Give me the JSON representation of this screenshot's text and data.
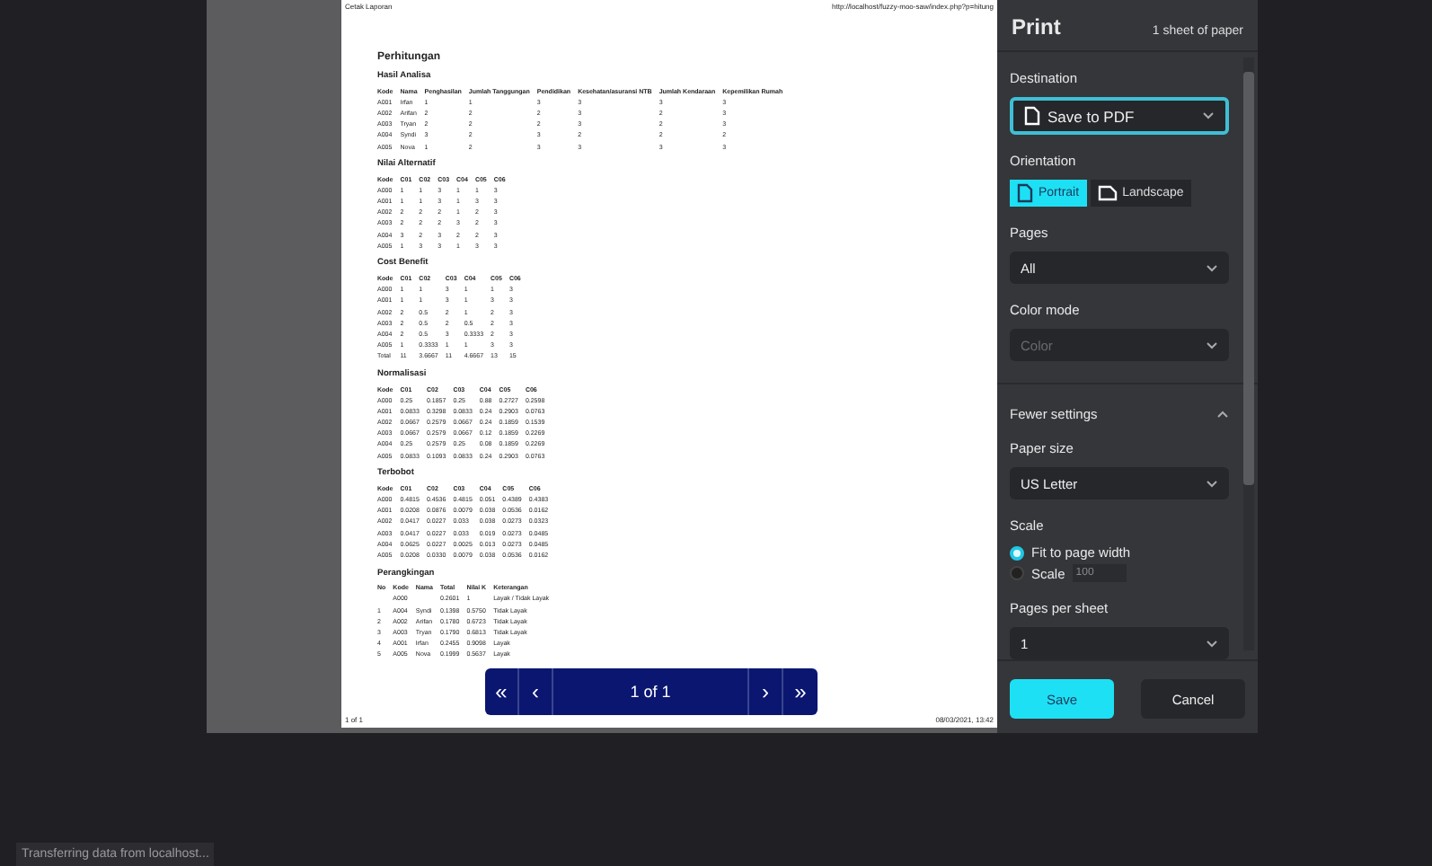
{
  "document": {
    "header_left": "Cetak Laporan",
    "header_right": "http://localhost/fuzzy-moo-saw/index.php?p=hitung",
    "title": "Perhitungan",
    "sections": [
      {
        "title": "Hasil Analisa",
        "columns": [
          "Kode",
          "Nama",
          "Penghasilan",
          "Jumlah Tanggungan",
          "Pendidikan",
          "Kesehatan/asuransi NTB",
          "Jumlah Kendaraan",
          "Kepemilikan Rumah"
        ],
        "rows": [
          [
            "A001",
            "Irfan",
            "1",
            "1",
            "3",
            "3",
            "3",
            "3"
          ],
          [
            "A002",
            "Arifan",
            "2",
            "2",
            "2",
            "3",
            "2",
            "3"
          ],
          [
            "A003",
            "Tryan",
            "2",
            "2",
            "2",
            "3",
            "2",
            "3"
          ],
          [
            "A004",
            "Syndi",
            "3",
            "2",
            "3",
            "2",
            "2",
            "2"
          ],
          [
            "A005",
            "Nova",
            "1",
            "2",
            "3",
            "3",
            "3",
            "3"
          ]
        ]
      },
      {
        "title": "Nilai Alternatif",
        "columns": [
          "Kode",
          "C01",
          "C02",
          "C03",
          "C04",
          "C05",
          "C06"
        ],
        "rows": [
          [
            "A000",
            "1",
            "1",
            "3",
            "1",
            "1",
            "3"
          ],
          [
            "A001",
            "1",
            "1",
            "3",
            "1",
            "3",
            "3"
          ],
          [
            "A002",
            "2",
            "2",
            "2",
            "1",
            "2",
            "3"
          ],
          [
            "A003",
            "2",
            "2",
            "2",
            "3",
            "2",
            "3"
          ],
          [
            "A004",
            "3",
            "2",
            "3",
            "2",
            "2",
            "3"
          ],
          [
            "A005",
            "1",
            "3",
            "3",
            "1",
            "3",
            "3"
          ]
        ]
      },
      {
        "title": "Cost Benefit",
        "columns": [
          "Kode",
          "C01",
          "C02",
          "C03",
          "C04",
          "C05",
          "C06"
        ],
        "rows": [
          [
            "A000",
            "1",
            "1",
            "3",
            "1",
            "1",
            "3"
          ],
          [
            "A001",
            "1",
            "1",
            "3",
            "1",
            "3",
            "3"
          ],
          [
            "A002",
            "2",
            "0.5",
            "2",
            "1",
            "2",
            "3"
          ],
          [
            "A003",
            "2",
            "0.5",
            "2",
            "0.5",
            "2",
            "3"
          ],
          [
            "A004",
            "2",
            "0.5",
            "3",
            "0.3333",
            "2",
            "3"
          ],
          [
            "A005",
            "1",
            "0.3333",
            "1",
            "1",
            "3",
            "3"
          ],
          [
            "Total",
            "11",
            "3.6667",
            "11",
            "4.6667",
            "13",
            "15"
          ]
        ]
      },
      {
        "title": "Normalisasi",
        "columns": [
          "Kode",
          "C01",
          "C02",
          "C03",
          "C04",
          "C05",
          "C06"
        ],
        "rows": [
          [
            "A000",
            "0.25",
            "0.1857",
            "0.25",
            "0.88",
            "0.2727",
            "0.2598"
          ],
          [
            "A001",
            "0.0833",
            "0.3298",
            "0.0833",
            "0.24",
            "0.2903",
            "0.0763"
          ],
          [
            "A002",
            "0.0667",
            "0.2579",
            "0.0667",
            "0.24",
            "0.1859",
            "0.1539"
          ],
          [
            "A003",
            "0.0667",
            "0.2579",
            "0.0667",
            "0.12",
            "0.1859",
            "0.2269"
          ],
          [
            "A004",
            "0.25",
            "0.2579",
            "0.25",
            "0.08",
            "0.1859",
            "0.2269"
          ],
          [
            "A005",
            "0.0833",
            "0.1093",
            "0.0833",
            "0.24",
            "0.2903",
            "0.0763"
          ]
        ]
      },
      {
        "title": "Terbobot",
        "columns": [
          "Kode",
          "C01",
          "C02",
          "C03",
          "C04",
          "C05",
          "C06"
        ],
        "rows": [
          [
            "A000",
            "0.4815",
            "0.4536",
            "0.4815",
            "0.051",
            "0.4389",
            "0.4383"
          ],
          [
            "A001",
            "0.0208",
            "0.0876",
            "0.0079",
            "0.038",
            "0.0536",
            "0.0162"
          ],
          [
            "A002",
            "0.0417",
            "0.0227",
            "0.033",
            "0.038",
            "0.0273",
            "0.0323"
          ],
          [
            "A003",
            "0.0417",
            "0.0227",
            "0.033",
            "0.019",
            "0.0273",
            "0.0485"
          ],
          [
            "A004",
            "0.0625",
            "0.0227",
            "0.0025",
            "0.013",
            "0.0273",
            "0.0485"
          ],
          [
            "A005",
            "0.0208",
            "0.0330",
            "0.0079",
            "0.038",
            "0.0536",
            "0.0162"
          ]
        ]
      },
      {
        "title": "Perangkingan",
        "columns": [
          "No",
          "Kode",
          "Nama",
          "Total",
          "Nilai K",
          "Keterangan"
        ],
        "rows": [
          [
            "",
            "A000",
            "",
            "0.2601",
            "1",
            "Layak / Tidak Layak"
          ],
          [
            "1",
            "A004",
            "Syndi",
            "0.1398",
            "0.5750",
            "Tidak Layak"
          ],
          [
            "2",
            "A002",
            "Arifan",
            "0.1780",
            "0.6723",
            "Tidak Layak"
          ],
          [
            "3",
            "A003",
            "Tryan",
            "0.1790",
            "0.6813",
            "Tidak Layak"
          ],
          [
            "4",
            "A001",
            "Irfan",
            "0.2455",
            "0.9098",
            "Layak"
          ],
          [
            "5",
            "A005",
            "Nova",
            "0.1999",
            "0.5637",
            "Layak"
          ]
        ]
      }
    ],
    "footer_left": "1 of 1",
    "footer_right": "08/03/2021, 13:42"
  },
  "pager": {
    "first": "«",
    "prev": "‹",
    "page": "1 of 1",
    "next": "›",
    "last": "»"
  },
  "print_panel": {
    "title": "Print",
    "sheets": "1 sheet of paper",
    "settings": [
      {
        "kind": "select",
        "label": "Destination",
        "value": "Save to PDF",
        "icon": true,
        "focused": true,
        "disabled": false
      },
      {
        "kind": "toggle",
        "label": "Orientation",
        "options": [
          {
            "label": "Portrait",
            "selected": true
          },
          {
            "label": "Landscape",
            "selected": false
          }
        ]
      },
      {
        "kind": "select",
        "label": "Pages",
        "value": "All",
        "icon": false,
        "focused": false,
        "disabled": false
      },
      {
        "kind": "select",
        "label": "Color mode",
        "value": "Color",
        "icon": false,
        "focused": false,
        "disabled": true
      },
      {
        "kind": "expander",
        "label": "Fewer settings",
        "expanded": true
      },
      {
        "kind": "select",
        "label": "Paper size",
        "value": "US Letter",
        "icon": false,
        "focused": false,
        "disabled": false
      },
      {
        "kind": "radios",
        "label": "Scale",
        "options": [
          {
            "label": "Fit to page width",
            "selected": true
          },
          {
            "label": "Scale",
            "selected": false,
            "value": "100"
          }
        ]
      },
      {
        "kind": "select",
        "label": "Pages per sheet",
        "value": "1",
        "icon": false,
        "focused": false,
        "disabled": false
      }
    ],
    "buttons": [
      {
        "label": "Save",
        "primary": true
      },
      {
        "label": "Cancel",
        "primary": false
      }
    ]
  },
  "status_bar": "Transferring data from localhost..."
}
